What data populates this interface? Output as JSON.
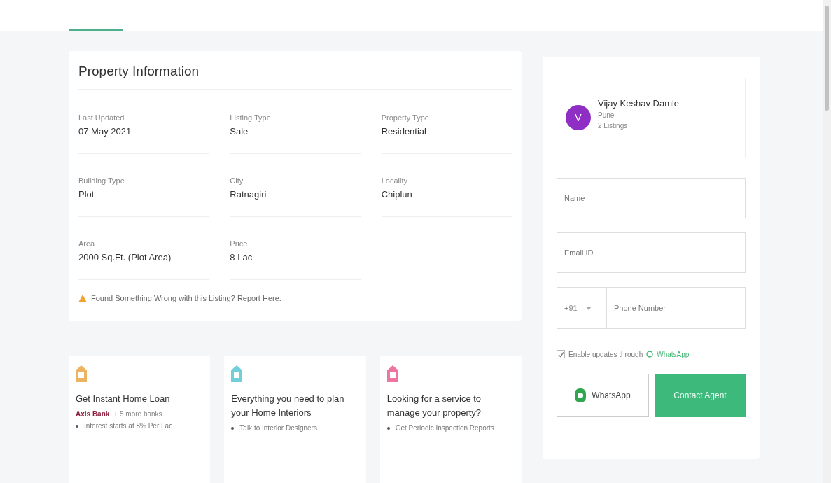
{
  "property_information": {
    "title": "Property Information",
    "fields": [
      {
        "label": "Last Updated",
        "value": "07 May 2021"
      },
      {
        "label": "Listing Type",
        "value": "Sale"
      },
      {
        "label": "Property Type",
        "value": "Residential"
      },
      {
        "label": "Building Type",
        "value": "Plot"
      },
      {
        "label": "City",
        "value": "Ratnagiri"
      },
      {
        "label": "Locality",
        "value": "Chiplun"
      },
      {
        "label": "Area",
        "value": "2000 Sq.Ft. (Plot Area)"
      },
      {
        "label": "Price",
        "value": "8 Lac"
      }
    ],
    "report_link": "Found Something Wrong with this Listing? Report Here."
  },
  "services": [
    {
      "kind": "loan",
      "title": "Get Instant Home Loan",
      "brand": "Axis Bank",
      "extra": "+ 5 more banks",
      "bullet": "Interest starts at 8% Per Lac"
    },
    {
      "kind": "interiors",
      "title": "Everything you need to plan your Home Interiors",
      "bullet": "Talk to Interior Designers"
    },
    {
      "kind": "manage",
      "title": "Looking for a service to manage your property?",
      "bullet": "Get Periodic Inspection Reports"
    }
  ],
  "agent": {
    "initial": "V",
    "name": "Vijay Keshav Damle",
    "location": "Pune",
    "listings": "2 Listings"
  },
  "contact_form": {
    "name": {
      "placeholder": "Name"
    },
    "email": {
      "placeholder": "Email ID"
    },
    "country_code": "+91",
    "phone": {
      "placeholder": "Phone Number"
    },
    "whatsapp_updates": {
      "label": "Enable updates through",
      "app": "WhatsApp",
      "checked": true
    },
    "buttons": [
      {
        "kind": "whatsapp",
        "label": "WhatsApp"
      },
      {
        "kind": "contact",
        "label": "Contact Agent"
      }
    ]
  }
}
